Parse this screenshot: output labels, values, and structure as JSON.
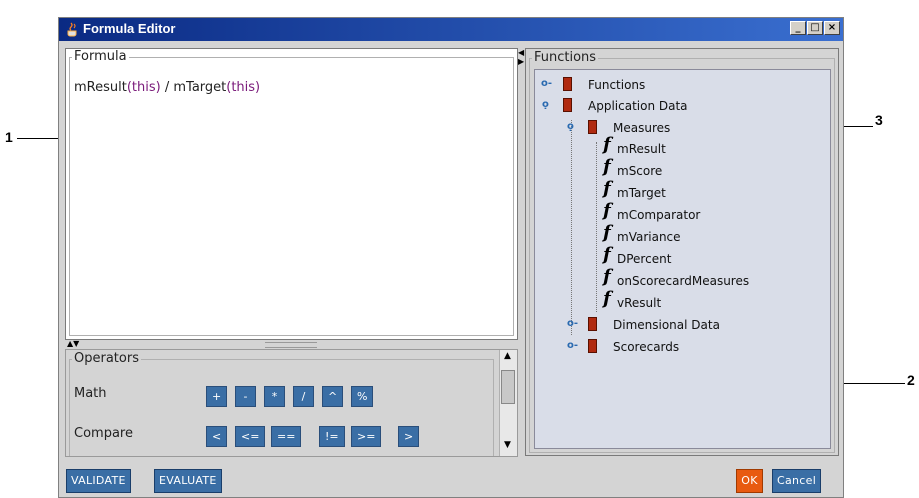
{
  "window": {
    "title": "Formula Editor"
  },
  "formula": {
    "legend": "Formula",
    "parts": [
      "mResult",
      "(this)",
      " / mTarget",
      "(this)"
    ]
  },
  "operators": {
    "legend": "Operators",
    "rows": [
      {
        "label": "Math",
        "ops": [
          "+",
          "-",
          "*",
          "/",
          "^",
          "%"
        ]
      },
      {
        "label": "Compare",
        "ops": [
          "<",
          "<=",
          "==",
          "!=",
          ">=",
          ">"
        ]
      }
    ]
  },
  "functions": {
    "legend": "Functions",
    "tree": {
      "functions_node": "Functions",
      "app_data": "Application Data",
      "measures": "Measures",
      "items": [
        "mResult",
        "mScore",
        "mTarget",
        "mComparator",
        "mVariance",
        "DPercent",
        "onScorecardMeasures",
        "vResult"
      ],
      "dimensional": "Dimensional Data",
      "scorecards": "Scorecards"
    },
    "fn_glyph": "f"
  },
  "buttons": {
    "validate": "VALIDATE",
    "evaluate": "EVALUATE",
    "ok": "OK",
    "cancel": "Cancel"
  },
  "callouts": {
    "c1": "1",
    "c2": "2",
    "c3": "3"
  },
  "colors": {
    "title_bar": "#0a2a83",
    "button": "#3a6ea5",
    "ok_button": "#e85a10",
    "tree_bg": "#d9dde8"
  }
}
